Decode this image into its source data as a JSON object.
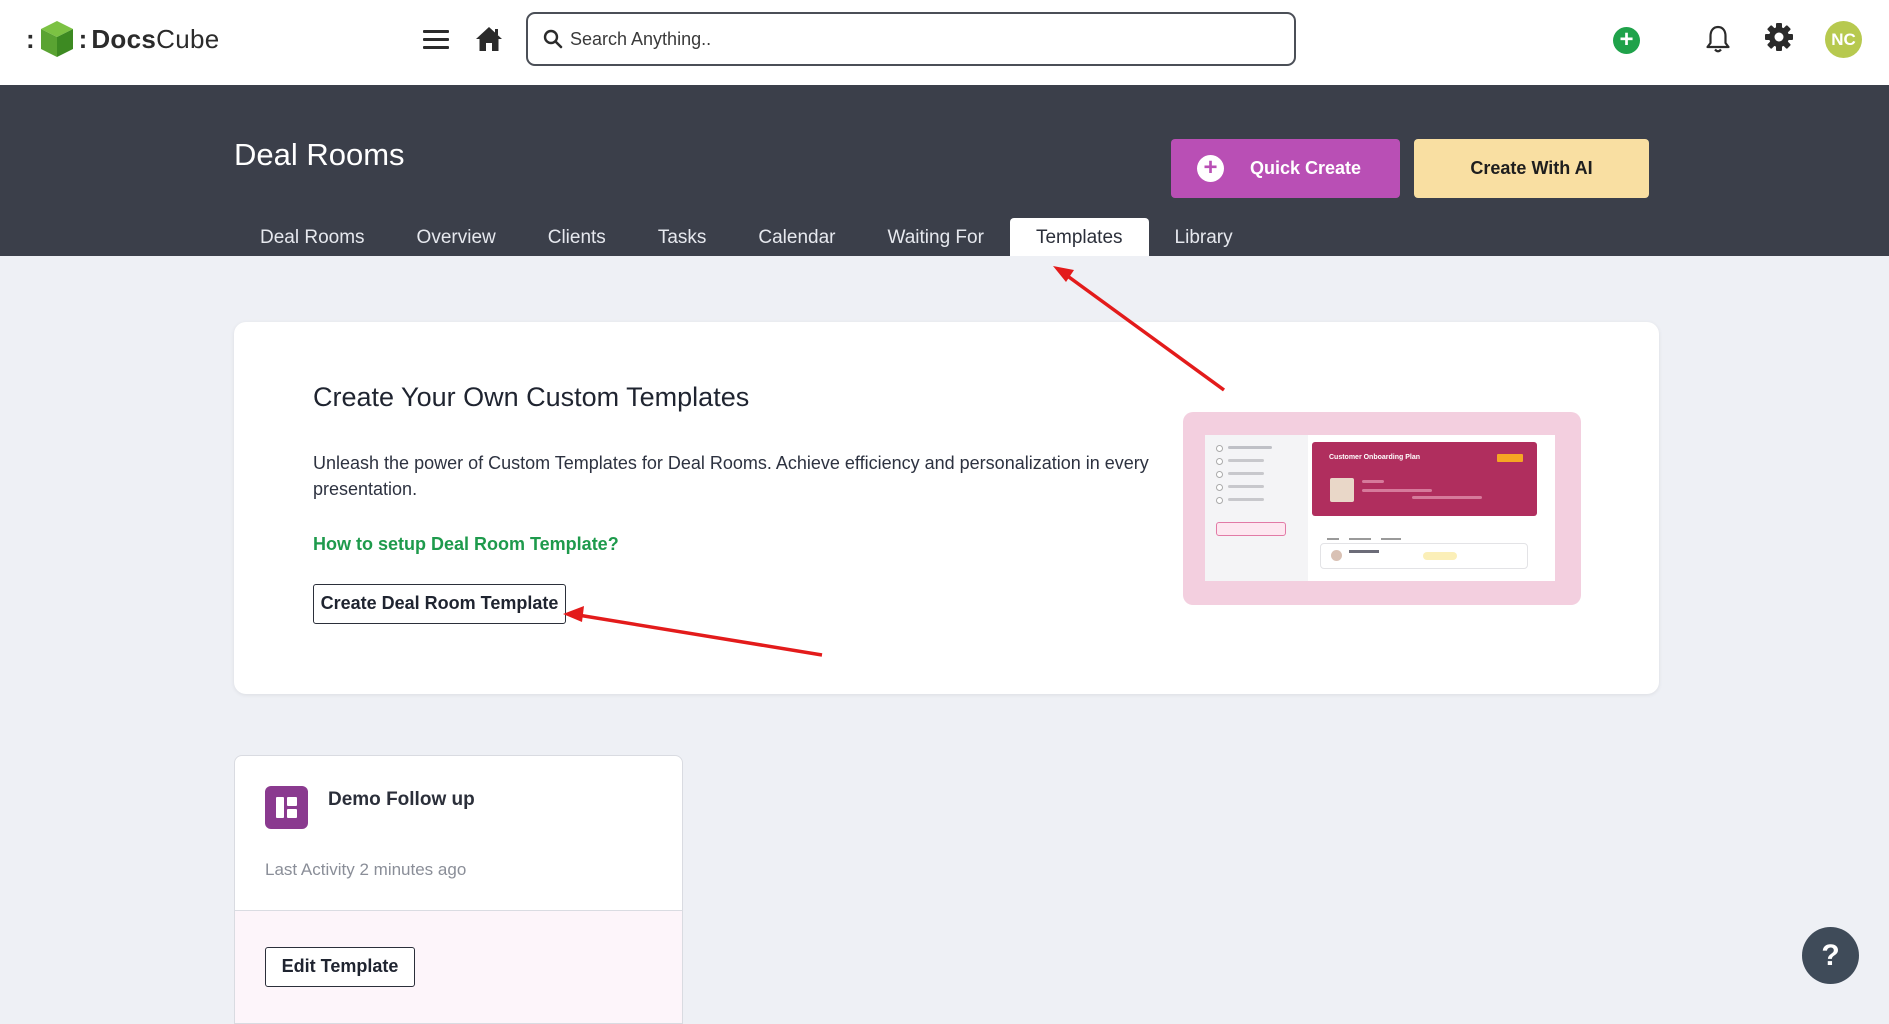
{
  "app": {
    "logo_prefix": ":",
    "brand_bold": "Docs",
    "brand_rest": "Cube"
  },
  "topbar": {
    "search_placeholder": "Search Anything..",
    "avatar_initials": "NC",
    "add_symbol": "+"
  },
  "header": {
    "title": "Deal Rooms",
    "quick_create_label": "Quick Create",
    "quick_create_symbol": "+",
    "create_ai_label": "Create With AI",
    "tabs": [
      {
        "label": "Deal Rooms"
      },
      {
        "label": "Overview"
      },
      {
        "label": "Clients"
      },
      {
        "label": "Tasks"
      },
      {
        "label": "Calendar"
      },
      {
        "label": "Waiting For"
      },
      {
        "label": "Templates",
        "active": true
      },
      {
        "label": "Library"
      }
    ]
  },
  "promo": {
    "title": "Create Your Own Custom Templates",
    "description": "Unleash the power of Custom Templates for Deal Rooms. Achieve efficiency and personalization in every presentation.",
    "howto_link": "How to setup Deal Room Template?",
    "create_button": "Create Deal Room Template",
    "preview_title": "Customer Onboarding Plan"
  },
  "templates": [
    {
      "name": "Demo Follow up",
      "activity": "Last Activity 2 minutes ago",
      "edit_label": "Edit Template"
    }
  ],
  "help": {
    "label": "?"
  },
  "colors": {
    "header_bg": "#3b3f4a",
    "quick_create": "#b94fb5",
    "create_ai": "#f9dfa2",
    "link_green": "#1e9a4c",
    "annotation_arrow": "#e31b1b"
  }
}
